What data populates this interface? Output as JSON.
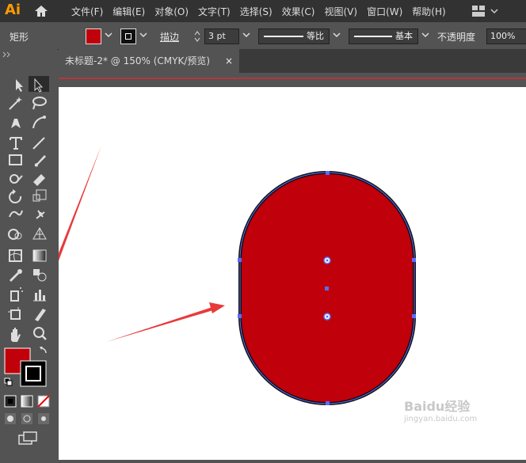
{
  "app": {
    "logo": "Ai"
  },
  "menu": [
    "文件(F)",
    "编辑(E)",
    "对象(O)",
    "文字(T)",
    "选择(S)",
    "效果(C)",
    "视图(V)",
    "窗口(W)",
    "帮助(H)"
  ],
  "control": {
    "shape_label": "矩形",
    "stroke_label": "描边",
    "stroke_value": "3 pt",
    "profile_label": "等比",
    "brush_label": "基本",
    "opacity_label": "不透明度",
    "opacity_value": "100%",
    "fill_color": "#c0000a"
  },
  "document": {
    "tab_title": "未标题-2* @ 150% (CMYK/预览)",
    "close": "×"
  },
  "shape": {
    "fill": "#c0000a",
    "stroke": "#111111",
    "path_color": "#5a6cff"
  },
  "annotation": {
    "arrow_color": "#e8393a"
  },
  "watermark": {
    "text": "Baidu经验",
    "sub": "jingyan.baidu.com"
  }
}
